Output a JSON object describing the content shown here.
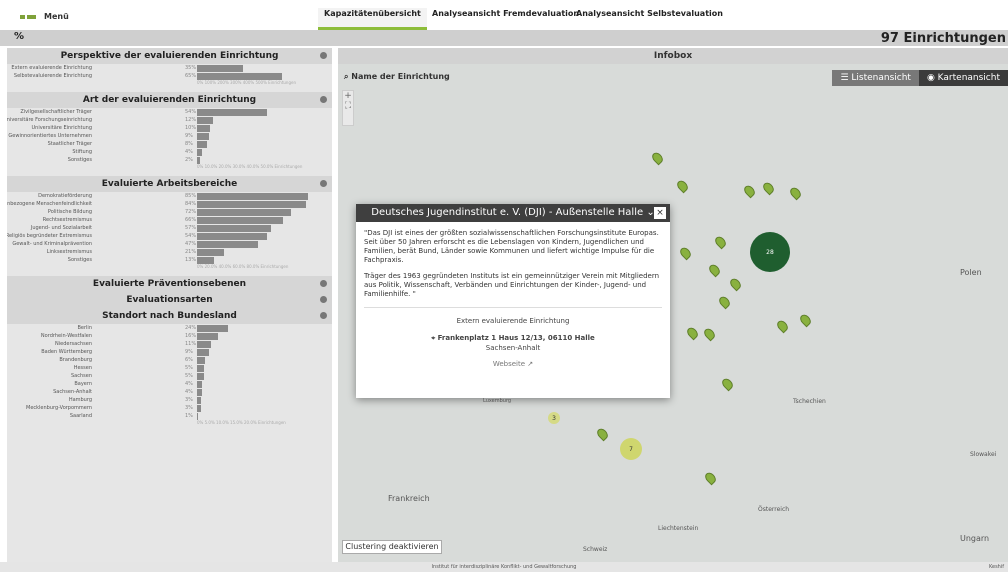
{
  "app": {
    "menu": "Menü",
    "pct": "%",
    "count": "97 Einrichtungen",
    "footer": "Institut für interdisziplinäre Konflikt- und Gewaltforschung",
    "kesh": "Keshif"
  },
  "tabs": [
    "Kapazitätenübersicht",
    "Analyseansicht Fremdevaluation",
    "Analyseansicht Selbstevaluation"
  ],
  "panels": [
    {
      "title": "Perspektive der evaluierenden Einrichtung",
      "rows": [
        [
          "Extern evaluierende Einrichtung",
          "35%",
          0.35
        ],
        [
          "Selbstevaluierende Einrichtung",
          "65%",
          0.65
        ]
      ],
      "axis": "0% 100% 200% 300% 400% 500% Einrichtungen"
    },
    {
      "title": "Art der evaluierenden Einrichtung",
      "rows": [
        [
          "Zivilgesellschaftlicher Träger",
          "54%",
          0.54
        ],
        [
          "Außeruniversitäre Forschungseinrichtung",
          "12%",
          0.12
        ],
        [
          "Universitäre Einrichtung",
          "10%",
          0.1
        ],
        [
          "Gewinnorientiertes Unternehmen",
          "9%",
          0.09
        ],
        [
          "Staatlicher Träger",
          "8%",
          0.08
        ],
        [
          "Stiftung",
          "4%",
          0.04
        ],
        [
          "Sonstiges",
          "2%",
          0.02
        ]
      ],
      "axis": "0% 10.0% 20.0% 30.0% 40.0% 50.0% Einrichtungen"
    },
    {
      "title": "Evaluierte Arbeitsbereiche",
      "rows": [
        [
          "Demokratieförderung",
          "85%",
          0.85
        ],
        [
          "Gruppenbezogene Menschenfeindlichkeit",
          "84%",
          0.84
        ],
        [
          "Politische Bildung",
          "72%",
          0.72
        ],
        [
          "Rechtsextremismus",
          "66%",
          0.66
        ],
        [
          "Jugend- und Sozialarbeit",
          "57%",
          0.57
        ],
        [
          "Religiös begründeter Extremismus",
          "54%",
          0.54
        ],
        [
          "Gewalt- und Kriminalprävention",
          "47%",
          0.47
        ],
        [
          "Linksextremismus",
          "21%",
          0.21
        ],
        [
          "Sonstiges",
          "13%",
          0.13
        ]
      ],
      "axis": "0% 20.0% 40.0% 60.0% 80.0% Einrichtungen"
    },
    {
      "title": "Evaluierte Präventionsebenen",
      "rows": []
    },
    {
      "title": "Evaluationsarten",
      "rows": []
    },
    {
      "title": "Standort nach Bundesland",
      "rows": [
        [
          "Berlin",
          "24%",
          0.24
        ],
        [
          "Nordrhein-Westfalen",
          "16%",
          0.16
        ],
        [
          "Niedersachsen",
          "11%",
          0.11
        ],
        [
          "Baden Württemberg",
          "9%",
          0.09
        ],
        [
          "Brandenburg",
          "6%",
          0.06
        ],
        [
          "Hessen",
          "5%",
          0.05
        ],
        [
          "Sachsen",
          "5%",
          0.05
        ],
        [
          "Bayern",
          "4%",
          0.04
        ],
        [
          "Sachsen-Anhalt",
          "4%",
          0.04
        ],
        [
          "Hamburg",
          "3%",
          0.03
        ],
        [
          "Mecklenburg-Vorpommern",
          "3%",
          0.03
        ],
        [
          "Saarland",
          "1%",
          0.01
        ]
      ],
      "axis": "0% 5.0% 10.0% 15.0% 20.0% Einrichtungen"
    }
  ],
  "map": {
    "title": "Infobox",
    "search": "Name der Einrichtung",
    "list": "Listenansicht",
    "mapview": "Kartenansicht",
    "cluster": "Clustering deaktivieren",
    "labels": [
      "Polen",
      "Frankreich",
      "Luxemburg",
      "Tschechien",
      "Slowakei",
      "Österreich",
      "Liechtenstein",
      "Schweiz",
      "Ungarn"
    ]
  },
  "popup": {
    "title": "Deutsches Jugendinstitut e. V. (DJI) - Außenstelle Halle",
    "q1": "\"Das DJI ist eines der größten sozialwissenschaftlichen Forschungsinstitute Europas. Seit über 50 Jahren erforscht es die Lebenslagen von Kindern, Jugendlichen und Familien, berät Bund, Länder sowie Kommunen und liefert wichtige Impulse für die Fachpraxis.",
    "q2": "Träger des 1963 gegründeten Instituts ist ein gemeinnütziger Verein mit Mitgliedern aus Politik, Wissenschaft, Verbänden und Einrichtungen der Kinder-, Jugend- und Familienhilfe. \"",
    "type": "Extern evaluierende Einrichtung",
    "addr": "Frankenplatz 1 Haus 12/13, 06110 Halle",
    "state": "Sachsen-Anhalt",
    "web": "Webseite"
  }
}
